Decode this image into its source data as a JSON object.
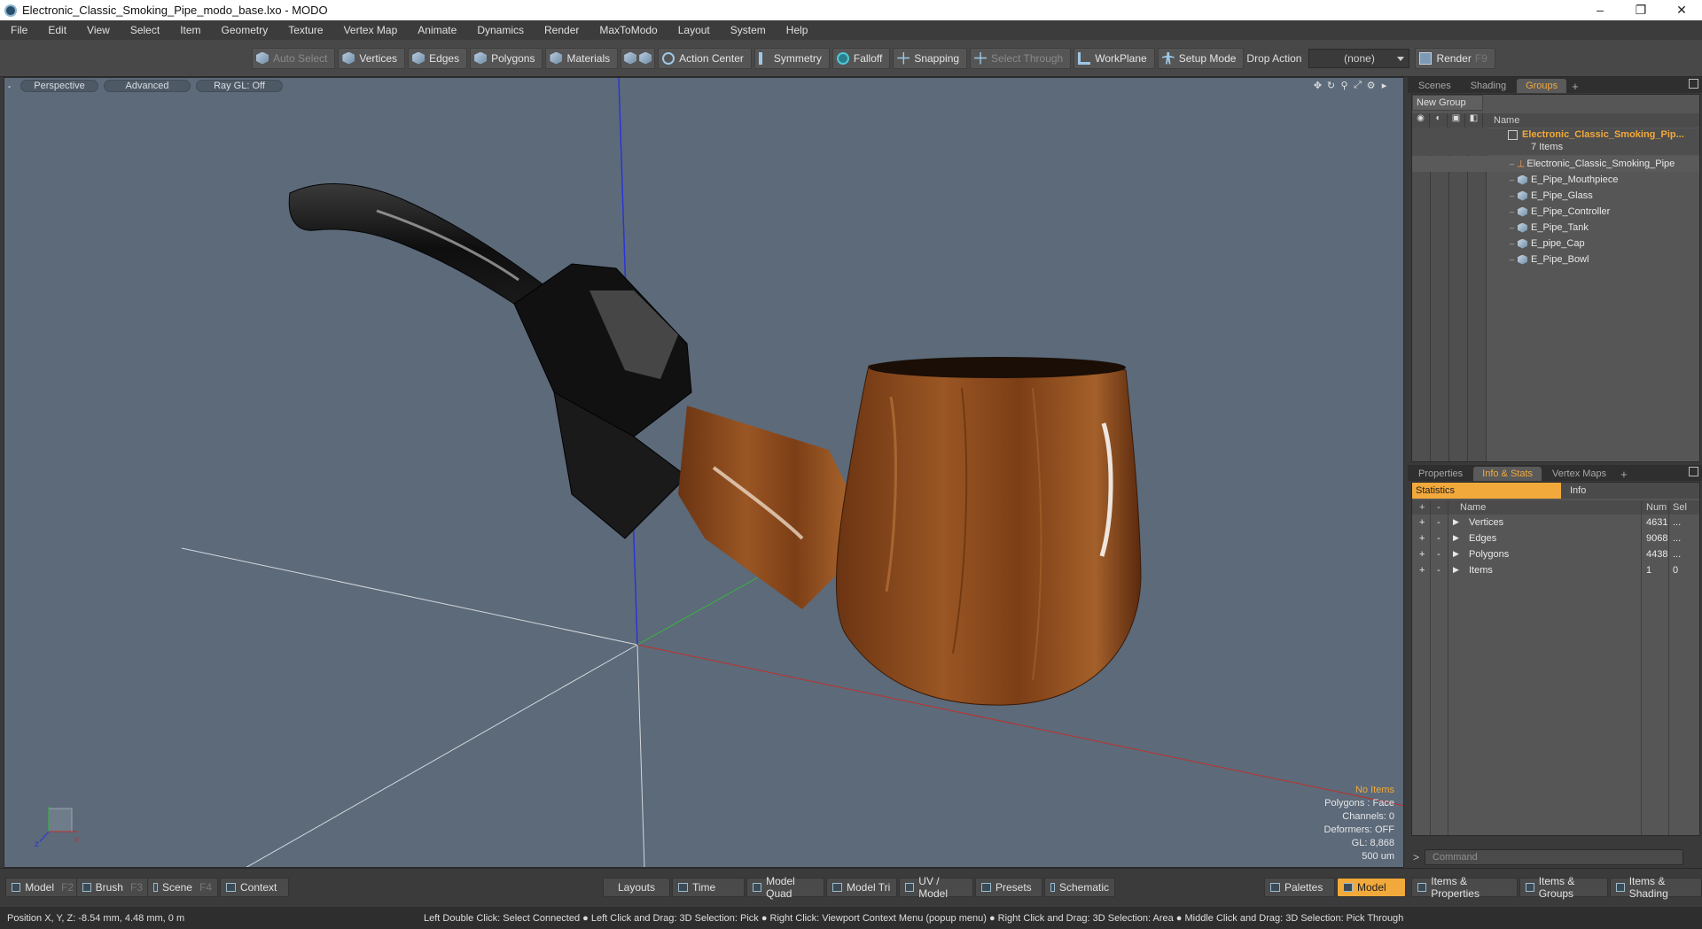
{
  "window": {
    "title": "Electronic_Classic_Smoking_Pipe_modo_base.lxo - MODO",
    "minimize": "–",
    "restore": "❐",
    "close": "✕"
  },
  "menu": [
    "File",
    "Edit",
    "View",
    "Select",
    "Item",
    "Geometry",
    "Texture",
    "Vertex Map",
    "Animate",
    "Dynamics",
    "Render",
    "MaxToModo",
    "Layout",
    "System",
    "Help"
  ],
  "toolbar": {
    "auto_select": "Auto Select",
    "vertices": "Vertices",
    "edges": "Edges",
    "polygons": "Polygons",
    "materials": "Materials",
    "action_center": "Action Center",
    "symmetry": "Symmetry",
    "falloff": "Falloff",
    "snapping": "Snapping",
    "select_through": "Select Through",
    "workplane": "WorkPlane",
    "setup_mode": "Setup Mode",
    "drop_action_label": "Drop Action",
    "drop_action_value": "(none)",
    "render": "Render",
    "render_key": "F9"
  },
  "viewport": {
    "tab_perspective": "Perspective",
    "tab_advanced": "Advanced",
    "tab_raygl": "Ray GL: Off",
    "info": {
      "no_items": "No Items",
      "polygons": "Polygons : Face",
      "channels": "Channels: 0",
      "deformers": "Deformers: OFF",
      "gl": "GL: 8,868",
      "scale": "500 um"
    },
    "axis_x": "x",
    "axis_z": "z"
  },
  "groups_panel": {
    "tabs": [
      "Scenes",
      "Shading",
      "Groups"
    ],
    "active_tab": "Groups",
    "new_group": "New Group",
    "col_name": "Name",
    "group_name": "Electronic_Classic_Smoking_Pip...",
    "group_count": "7 Items",
    "items": [
      "Electronic_Classic_Smoking_Pipe",
      "E_Pipe_Mouthpiece",
      "E_Pipe_Glass",
      "E_Pipe_Controller",
      "E_Pipe_Tank",
      "E_pipe_Cap",
      "E_Pipe_Bowl"
    ]
  },
  "info_panel": {
    "tabs": [
      "Properties",
      "Info & Stats",
      "Vertex Maps"
    ],
    "active_tab": "Info & Stats",
    "statistics": "Statistics",
    "info": "Info",
    "col_name": "Name",
    "col_num": "Num",
    "col_sel": "Sel",
    "rows": [
      {
        "name": "Vertices",
        "num": "4631",
        "sel": "..."
      },
      {
        "name": "Edges",
        "num": "9068",
        "sel": "..."
      },
      {
        "name": "Polygons",
        "num": "4438",
        "sel": "..."
      },
      {
        "name": "Items",
        "num": "1",
        "sel": "0"
      }
    ]
  },
  "command": {
    "prompt": ">",
    "placeholder": "Command"
  },
  "bottom": {
    "model": "Model",
    "model_key": "F2",
    "brush": "Brush",
    "brush_key": "F3",
    "scene": "Scene",
    "scene_key": "F4",
    "context": "Context",
    "layouts": "Layouts",
    "time": "Time",
    "model_quad": "Model Quad",
    "model_tri": "Model Tri",
    "uv_model": "UV / Model",
    "presets": "Presets",
    "schematic": "Schematic",
    "palettes": "Palettes",
    "model_active": "Model",
    "items_props": "Items & Properties",
    "items_groups": "Items & Groups",
    "items_shading": "Items & Shading"
  },
  "status": {
    "position": "Position X, Y, Z:  -8.54 mm, 4.48 mm, 0 m",
    "hints": "Left Double Click: Select Connected ● Left Click and Drag: 3D Selection: Pick ● Right Click: Viewport Context Menu (popup menu) ● Right Click and Drag: 3D Selection: Area ● Middle Click and Drag: 3D Selection: Pick Through"
  },
  "colors": {
    "accent": "#f2a93b",
    "viewport_bg": "#5c6a7a",
    "wood": "#8a4a1e"
  }
}
